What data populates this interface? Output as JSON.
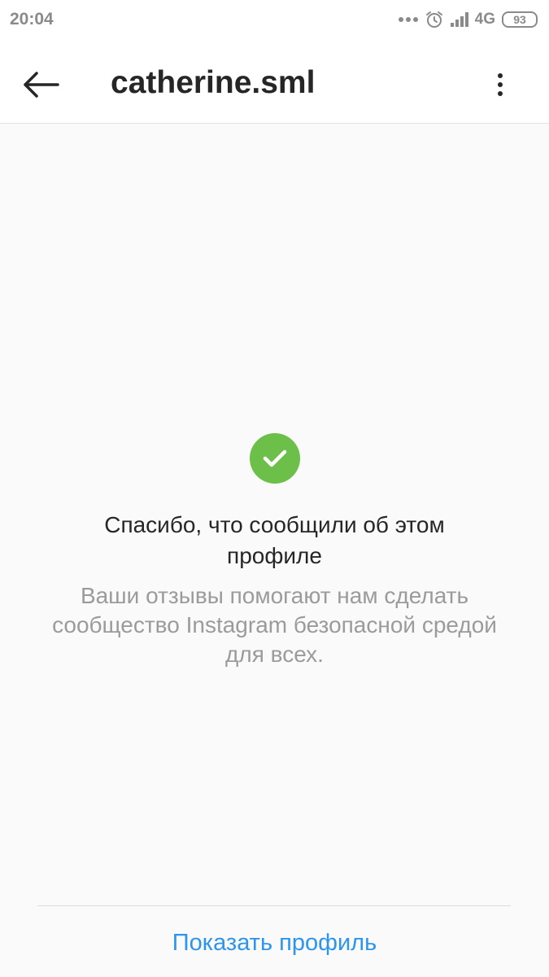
{
  "status_bar": {
    "time": "20:04",
    "network": "4G",
    "battery": "93"
  },
  "header": {
    "title": "catherine.sml",
    "back_icon": "arrow-left-icon",
    "more_icon": "more-vertical-icon"
  },
  "confirmation": {
    "icon": "check-circle-icon",
    "title": "Спасибо, что сообщили об этом профиле",
    "description": "Ваши отзывы помогают нам сделать сообщество Instagram безопасной средой для всех."
  },
  "footer": {
    "show_profile_label": "Показать профиль"
  },
  "colors": {
    "accent": "#2d95ee",
    "success": "#6cc04a",
    "title_text": "#262626",
    "secondary_text": "#9b9b9b",
    "background": "#fafafa"
  }
}
